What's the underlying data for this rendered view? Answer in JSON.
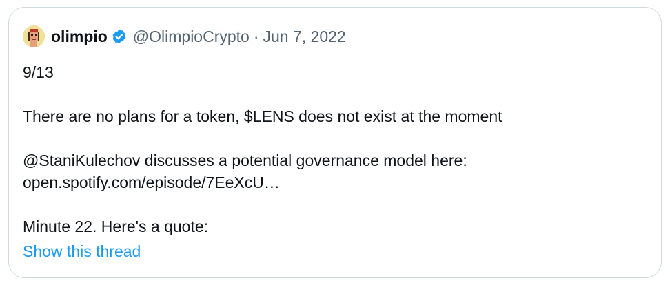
{
  "tweet": {
    "display_name": "olimpio",
    "handle": "@OlimpioCrypto",
    "separator": "·",
    "date": "Jun 7, 2022",
    "avatar_icon": "pixel-character-avatar",
    "verified_icon": "verified-badge-icon",
    "lines": {
      "counter": "9/13",
      "token_statement": "There are no plans for a token, $LENS does not exist at the moment",
      "mention": "@StaniKulechov",
      "mention_rest": " discusses a potential governance model here:",
      "link": "open.spotify.com/episode/7EeXcU…",
      "quote_intro": "Minute 22. Here's a quote:"
    },
    "show_thread": "Show this thread"
  },
  "colors": {
    "border": "#cfd9de",
    "text": "#0f1419",
    "secondary": "#536471",
    "accent": "#1d9bf0",
    "avatar_bg": "#efe19a"
  }
}
